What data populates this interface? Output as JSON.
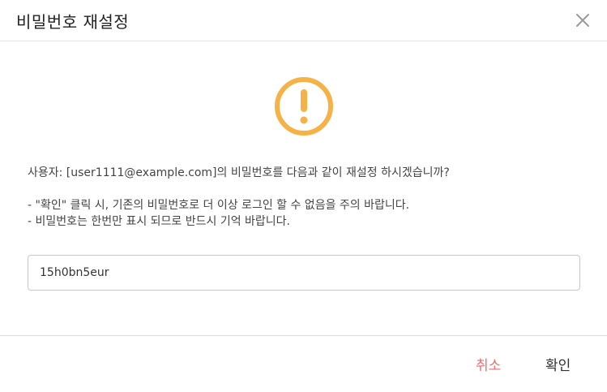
{
  "dialog": {
    "title": "비밀번호 재설정",
    "message": "사용자: [user1111@example.com]의 비밀번호를 다음과 같이 재설정 하시겠습니까?",
    "note1": "- \"확인\" 클릭 시, 기존의 비밀번호로 더 이상 로그인 할 수 없음을 주의 바랍니다.",
    "note2": "- 비밀번호는 한번만 표시 되므로 반드시 기억 바랍니다.",
    "password_value": "15h0bn5eur",
    "cancel_label": "취소",
    "confirm_label": "확인",
    "icons": {
      "close": "close-icon",
      "warning": "warning-icon"
    },
    "colors": {
      "warning": "#f6b246",
      "cancel": "#ef6f6f"
    }
  }
}
